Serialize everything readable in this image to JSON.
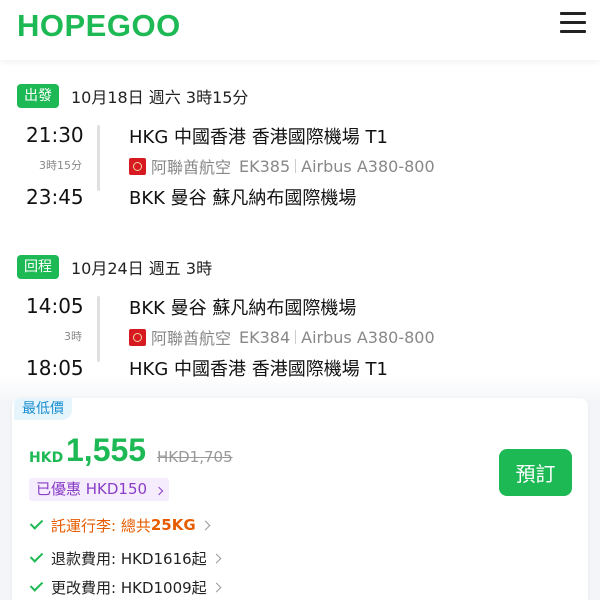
{
  "header": {
    "logo": "HOPEGOO"
  },
  "outbound": {
    "badge": "出發",
    "info": "10月18日 週六  3時15分",
    "depart_time": "21:30",
    "duration": "3時15分",
    "arrive_time": "23:45",
    "from_airport": "HKG 中國香港 香港國際機場 T1",
    "airline": "阿聯酋航空",
    "flight_no": "EK385",
    "aircraft": "Airbus A380-800",
    "to_airport": "BKK 曼谷 蘇凡納布國際機場"
  },
  "return": {
    "badge": "回程",
    "info": "10月24日 週五  3時",
    "depart_time": "14:05",
    "duration": "3時",
    "arrive_time": "18:05",
    "from_airport": "BKK 曼谷 蘇凡納布國際機場",
    "airline": "阿聯酋航空",
    "flight_no": "EK384",
    "aircraft": "Airbus A380-800",
    "to_airport": "HKG 中國香港 香港國際機場 T1"
  },
  "price": {
    "tag": "最低價",
    "currency": "HKD",
    "amount": "1,555",
    "original": "HKD1,705",
    "discount": "已優惠 HKD150",
    "book_label": "預訂"
  },
  "features": {
    "baggage_prefix": "託運行李: 總共",
    "baggage_value": "25KG",
    "refund": "退款費用: HKD1616起",
    "change": "更改費用: HKD1009起"
  },
  "colors": {
    "brand": "#1db954",
    "discount": "#8a3ec6",
    "tag": "#1a8fd1",
    "highlight": "#e65c00"
  }
}
